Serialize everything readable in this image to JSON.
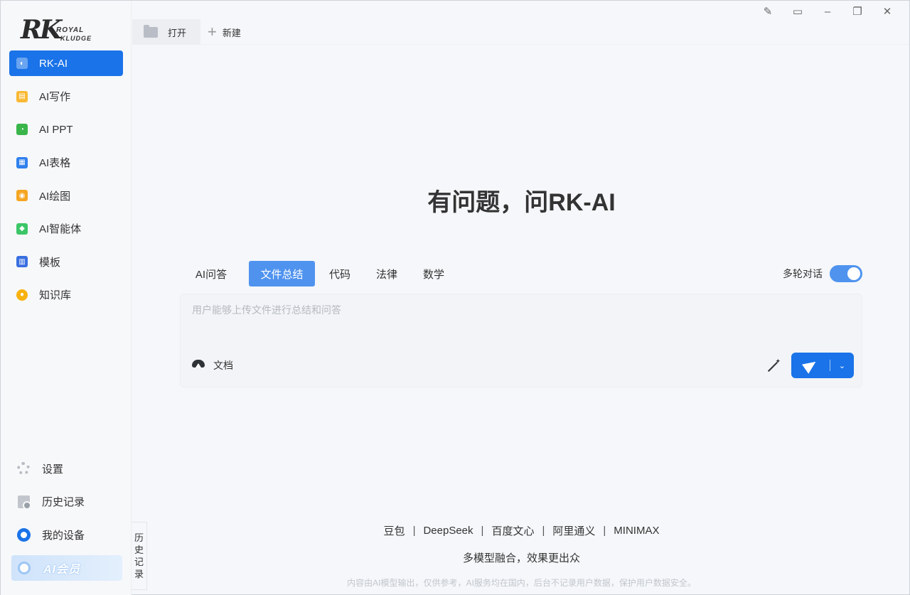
{
  "logo": {
    "mark": "RK",
    "line1": "ROYAL",
    "line2": "KLUDGE"
  },
  "sidebar": {
    "items": [
      {
        "label": "RK-AI",
        "icon": "rk-ai-icon",
        "color": "#ffffff",
        "active": true
      },
      {
        "label": "AI写作",
        "icon": "ai-writing-icon",
        "color": "#f9b934"
      },
      {
        "label": "AI PPT",
        "icon": "ai-ppt-icon",
        "color": "#39b54a"
      },
      {
        "label": "AI表格",
        "icon": "ai-table-icon",
        "color": "#2f80ed"
      },
      {
        "label": "AI绘图",
        "icon": "ai-drawing-icon",
        "color": "#f5a623"
      },
      {
        "label": "AI智能体",
        "icon": "ai-agent-icon",
        "color": "#3cc668"
      },
      {
        "label": "模板",
        "icon": "template-icon",
        "color": "#3a6fe0"
      },
      {
        "label": "知识库",
        "icon": "knowledge-base-icon",
        "color": "#f8b20e"
      }
    ],
    "bottom": [
      {
        "label": "设置",
        "icon": "gear-icon"
      },
      {
        "label": "历史记录",
        "icon": "history-icon"
      },
      {
        "label": "我的设备",
        "icon": "device-icon"
      }
    ],
    "member_label": "AI会员"
  },
  "history_tab": [
    "历",
    "史",
    "记",
    "录"
  ],
  "topbar": {
    "open_label": "打开",
    "new_label": "新建"
  },
  "window_controls": [
    "✎",
    "▭",
    "–",
    "❐",
    "✕"
  ],
  "main": {
    "title": "有问题，问RK-AI",
    "modes": [
      "AI问答",
      "文件总结",
      "代码",
      "法律",
      "数学"
    ],
    "active_mode": "文件总结",
    "multi_turn_label": "多轮对话",
    "multi_turn_on": true,
    "input_placeholder": "用户能够上传文件进行总结和问答",
    "doc_label": "文档"
  },
  "footer": {
    "models": [
      "豆包",
      "DeepSeek",
      "百度文心",
      "阿里通义",
      "MINIMAX"
    ],
    "slogan": "多模型融合，效果更出众",
    "disclaimer": "内容由AI模型输出，仅供参考，AI服务均在国内，后台不记录用户数据，保护用户数据安全。"
  },
  "colors": {
    "accent": "#1a73e8",
    "mode_active": "#4f93ef"
  }
}
